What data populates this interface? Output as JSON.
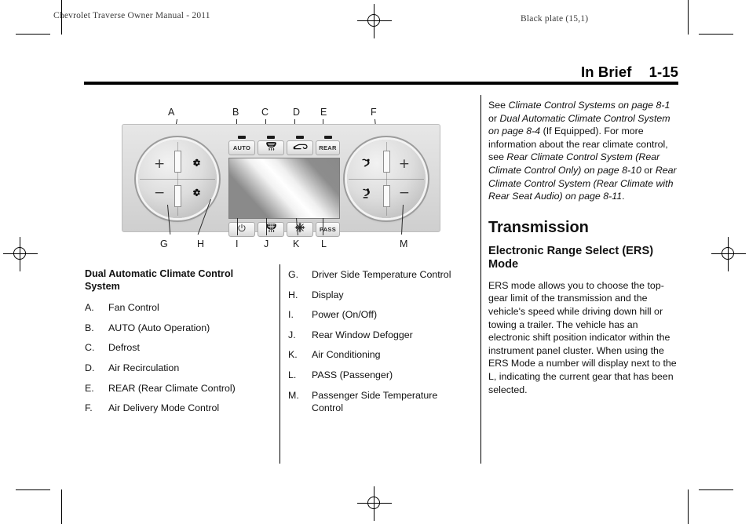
{
  "running_head": {
    "left": "Chevrolet Traverse Owner Manual - 2011",
    "right": "Black plate (15,1)"
  },
  "page_title": {
    "chapter": "In Brief",
    "page_number": "1-15"
  },
  "figure": {
    "name": "dual-automatic-climate-control-panel",
    "callout_letters": [
      "A",
      "B",
      "C",
      "D",
      "E",
      "F",
      "G",
      "H",
      "I",
      "J",
      "K",
      "L",
      "M"
    ],
    "buttons_top": [
      {
        "label": "AUTO",
        "icon": "auto-text-button"
      },
      {
        "label": "",
        "icon": "windshield-defrost-icon"
      },
      {
        "label": "",
        "icon": "air-recirculation-icon"
      },
      {
        "label": "REAR",
        "icon": "rear-text-button"
      }
    ],
    "buttons_bottom": [
      {
        "label": "",
        "icon": "power-icon"
      },
      {
        "label": "",
        "icon": "rear-window-defogger-icon"
      },
      {
        "label": "",
        "icon": "air-conditioning-icon"
      },
      {
        "label": "PASS",
        "icon": "pass-text-button"
      }
    ],
    "knob_driver": {
      "name": "driver-temperature-knob",
      "plus": "+",
      "minus": "−",
      "glyph_top": "fan-icon",
      "glyph_bottom": "fan-icon"
    },
    "knob_passenger": {
      "name": "passenger-temperature-knob",
      "plus": "+",
      "minus": "−",
      "glyph_top": "air-delivery-upper-icon",
      "glyph_bottom": "air-delivery-floor-icon"
    }
  },
  "left_column": {
    "heading": "Dual Automatic Climate Control System",
    "items": [
      {
        "key": "A.",
        "text": "Fan Control"
      },
      {
        "key": "B.",
        "text": "AUTO (Auto Operation)"
      },
      {
        "key": "C.",
        "text": "Defrost"
      },
      {
        "key": "D.",
        "text": "Air Recirculation"
      },
      {
        "key": "E.",
        "text": "REAR (Rear Climate Control)"
      },
      {
        "key": "F.",
        "text": "Air Delivery Mode Control"
      }
    ]
  },
  "middle_column": {
    "items": [
      {
        "key": "G.",
        "text": "Driver Side Temperature Control"
      },
      {
        "key": "H.",
        "text": "Display"
      },
      {
        "key": "I.",
        "text": "Power (On/Off)"
      },
      {
        "key": "J.",
        "text": "Rear Window Defogger"
      },
      {
        "key": "K.",
        "text": "Air Conditioning"
      },
      {
        "key": "L.",
        "text": "PASS (Passenger)"
      },
      {
        "key": "M.",
        "text": "Passenger Side Temperature Control"
      }
    ]
  },
  "right_column": {
    "cross_reference_paragraph": {
      "s1": "See ",
      "ref1": "Climate Control Systems on page 8-1",
      "s2": " or ",
      "ref2": "Dual Automatic Climate Control System on page 8-4",
      "s3": " (If Equipped). For more information about the rear climate control, see ",
      "ref3": "Rear Climate Control System (Rear Climate Control Only) on page 8-10",
      "s4": " or ",
      "ref4": "Rear Climate Control System (Rear Climate with Rear Seat Audio) on page 8-11",
      "s5": "."
    },
    "transmission_heading": "Transmission",
    "ers_heading": "Electronic Range Select (ERS) Mode",
    "ers_paragraph": "ERS mode allows you to choose the top-gear limit of the transmission and the vehicle's speed while driving down hill or towing a trailer. The vehicle has an electronic shift position indicator within the instrument panel cluster. When using the ERS Mode a number will display next to the L, indicating the current gear that has been selected."
  }
}
